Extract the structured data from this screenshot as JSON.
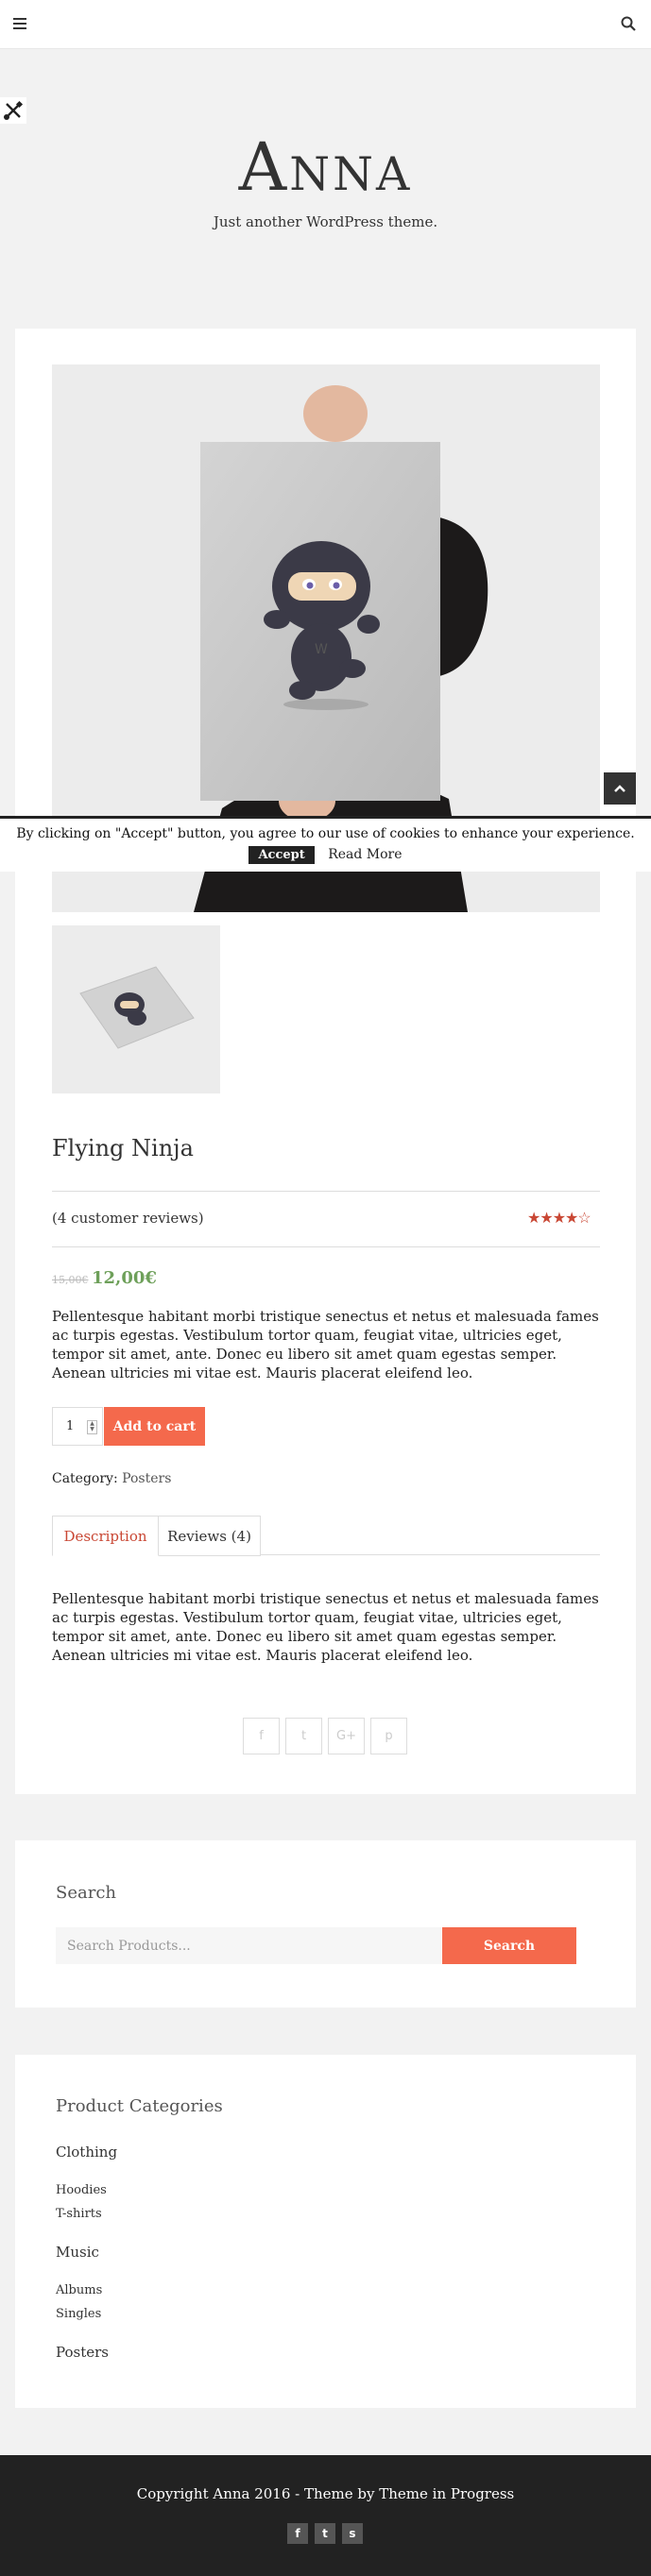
{
  "site": {
    "title": "Anna",
    "tagline": "Just another WordPress theme."
  },
  "product": {
    "title": "Flying Ninja",
    "reviews_link": "(4 customer reviews)",
    "rating": 4,
    "rating_max": 5,
    "price_old": "15,00€",
    "price_new": "12,00€",
    "short_description": "Pellentesque habitant morbi tristique senectus et netus et malesuada fames ac turpis egestas. Vestibulum tortor quam, feugiat vitae, ultricies eget, tempor sit amet, ante. Donec eu libero sit amet quam egestas semper. Aenean ultricies mi vitae est. Mauris placerat eleifend leo.",
    "quantity": "1",
    "add_to_cart_label": "Add to cart",
    "category_label": "Category:",
    "category_value": "Posters",
    "tabs": [
      {
        "label": "Description",
        "active": true
      },
      {
        "label": "Reviews (4)",
        "active": false
      }
    ],
    "long_description": "Pellentesque habitant morbi tristique senectus et netus et malesuada fames ac turpis egestas. Vestibulum tortor quam, feugiat vitae, ultricies eget, tempor sit amet, ante. Donec eu libero sit amet quam egestas semper. Aenean ultricies mi vitae est. Mauris placerat eleifend leo.",
    "share_icons": [
      "f",
      "t",
      "G+",
      "p"
    ]
  },
  "cookie": {
    "text": "By clicking on \"Accept\" button, you agree to our use of cookies to enhance your experience.",
    "accept_label": "Accept",
    "read_more_label": "Read More"
  },
  "search_widget": {
    "title": "Search",
    "placeholder": "Search Products...",
    "button_label": "Search"
  },
  "categories_widget": {
    "title": "Product Categories",
    "groups": [
      {
        "label": "Clothing",
        "children": [
          "Hoodies",
          "T-shirts"
        ]
      },
      {
        "label": "Music",
        "children": [
          "Albums",
          "Singles"
        ]
      },
      {
        "label": "Posters",
        "children": []
      }
    ]
  },
  "footer": {
    "copyright": "Copyright Anna 2016 - Theme by Theme in Progress",
    "social": [
      "f",
      "t",
      "s"
    ]
  },
  "colors": {
    "accent": "#f4694c",
    "price_green": "#6ea05a",
    "star_red": "#c94734",
    "footer_bg": "#222222"
  }
}
